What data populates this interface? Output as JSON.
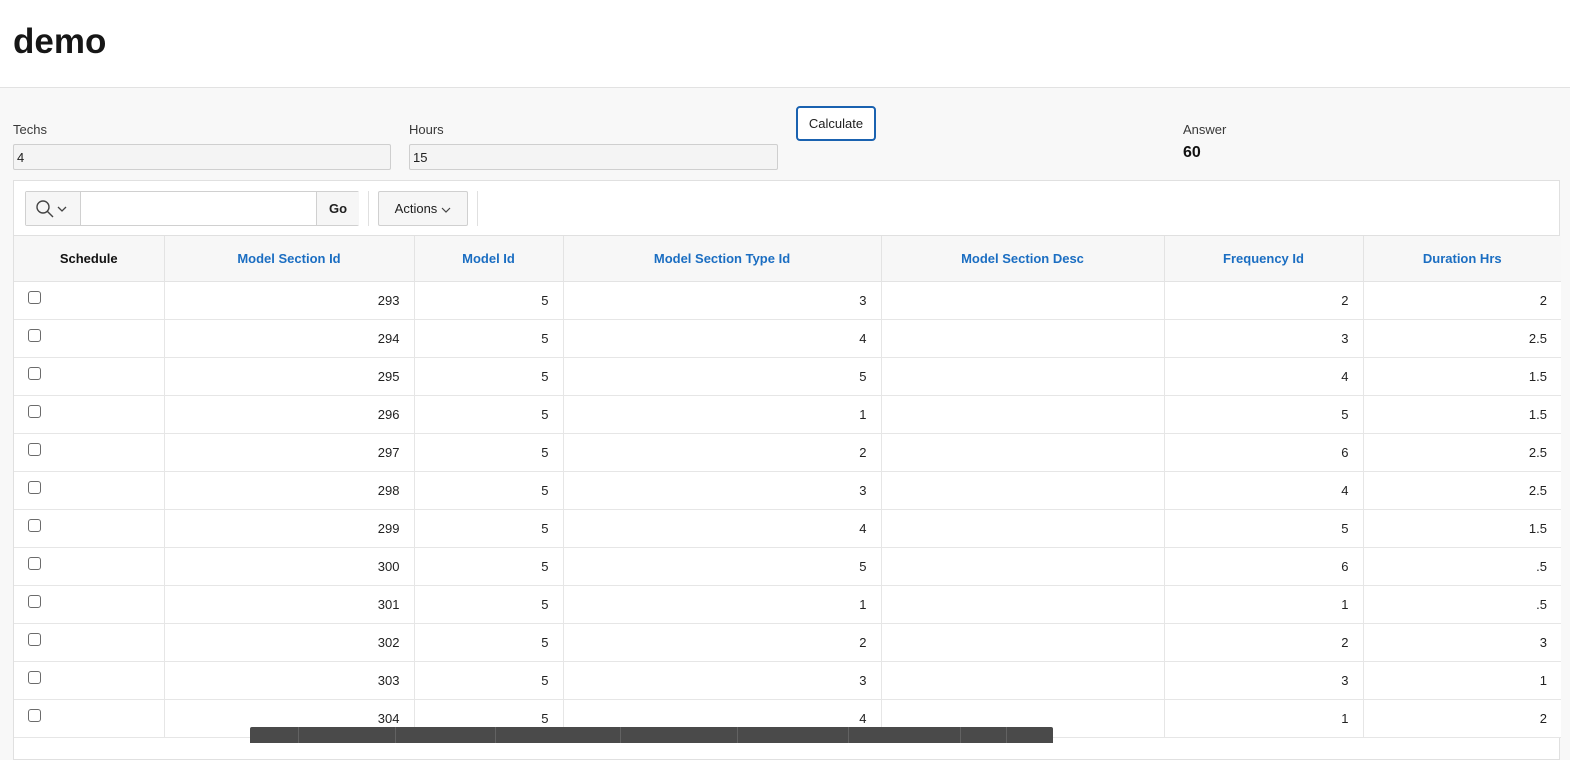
{
  "page": {
    "title": "demo"
  },
  "form": {
    "techs": {
      "label": "Techs",
      "value": "4"
    },
    "hours": {
      "label": "Hours",
      "value": "15"
    },
    "calculate_label": "Calculate",
    "answer": {
      "label": "Answer",
      "value": "60"
    }
  },
  "report": {
    "search": {
      "placeholder": "",
      "go_label": "Go"
    },
    "actions_label": "Actions",
    "columns": [
      "Schedule",
      "Model Section Id",
      "Model Id",
      "Model Section Type Id",
      "Model Section Desc",
      "Frequency Id",
      "Duration Hrs"
    ],
    "rows": [
      {
        "model_section_id": "293",
        "model_id": "5",
        "model_section_type_id": "3",
        "model_section_desc": "",
        "frequency_id": "2",
        "duration_hrs": "2"
      },
      {
        "model_section_id": "294",
        "model_id": "5",
        "model_section_type_id": "4",
        "model_section_desc": "",
        "frequency_id": "3",
        "duration_hrs": "2.5"
      },
      {
        "model_section_id": "295",
        "model_id": "5",
        "model_section_type_id": "5",
        "model_section_desc": "",
        "frequency_id": "4",
        "duration_hrs": "1.5"
      },
      {
        "model_section_id": "296",
        "model_id": "5",
        "model_section_type_id": "1",
        "model_section_desc": "",
        "frequency_id": "5",
        "duration_hrs": "1.5"
      },
      {
        "model_section_id": "297",
        "model_id": "5",
        "model_section_type_id": "2",
        "model_section_desc": "",
        "frequency_id": "6",
        "duration_hrs": "2.5"
      },
      {
        "model_section_id": "298",
        "model_id": "5",
        "model_section_type_id": "3",
        "model_section_desc": "",
        "frequency_id": "4",
        "duration_hrs": "2.5"
      },
      {
        "model_section_id": "299",
        "model_id": "5",
        "model_section_type_id": "4",
        "model_section_desc": "",
        "frequency_id": "5",
        "duration_hrs": "1.5"
      },
      {
        "model_section_id": "300",
        "model_id": "5",
        "model_section_type_id": "5",
        "model_section_desc": "",
        "frequency_id": "6",
        "duration_hrs": ".5"
      },
      {
        "model_section_id": "301",
        "model_id": "5",
        "model_section_type_id": "1",
        "model_section_desc": "",
        "frequency_id": "1",
        "duration_hrs": ".5"
      },
      {
        "model_section_id": "302",
        "model_id": "5",
        "model_section_type_id": "2",
        "model_section_desc": "",
        "frequency_id": "2",
        "duration_hrs": "3"
      },
      {
        "model_section_id": "303",
        "model_id": "5",
        "model_section_type_id": "3",
        "model_section_desc": "",
        "frequency_id": "3",
        "duration_hrs": "1"
      },
      {
        "model_section_id": "304",
        "model_id": "5",
        "model_section_type_id": "4",
        "model_section_desc": "",
        "frequency_id": "1",
        "duration_hrs": "2"
      }
    ]
  },
  "icons": {
    "search": "search-icon",
    "chevron": "chevron-down-icon",
    "checkbox": "checkbox-icon"
  },
  "colors": {
    "link_blue": "#1b6ec2",
    "button_border": "#1a62b0",
    "dev_toolbar": "#4a4a4a"
  }
}
